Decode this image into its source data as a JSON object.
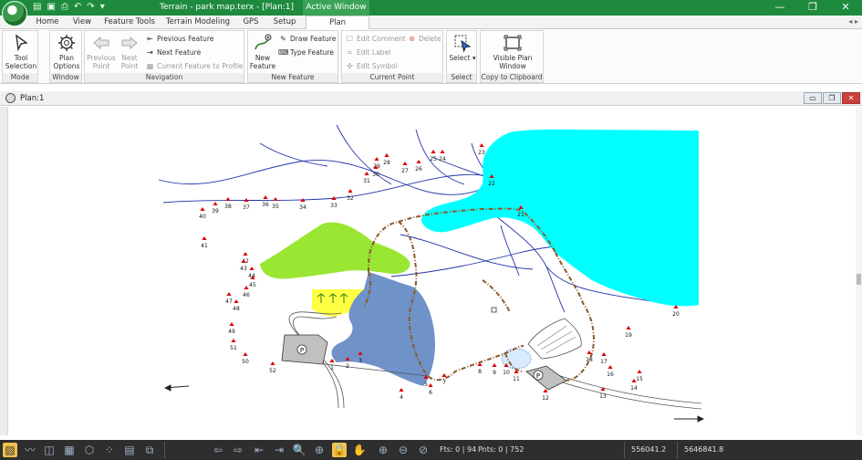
{
  "app": {
    "title": "Terrain - park map.terx - [Plan:1]",
    "active_window_label": "Active Window",
    "logo": "terrain-logo"
  },
  "window_controls": [
    "—",
    "❐",
    "✕"
  ],
  "tabs": [
    {
      "label": "Home"
    },
    {
      "label": "View"
    },
    {
      "label": "Feature Tools"
    },
    {
      "label": "Terrain Modeling"
    },
    {
      "label": "GPS"
    },
    {
      "label": "Setup"
    },
    {
      "label": "Plan",
      "active": true
    }
  ],
  "ribbon": {
    "mode": {
      "label": "Mode",
      "tool_selection": "Tool Selection ▾"
    },
    "window": {
      "label": "Window",
      "plan_options": "Plan Options"
    },
    "navigation": {
      "label": "Navigation",
      "previous_point": "Previous Point",
      "next_point": "Next Point",
      "previous_feature": "Previous Feature",
      "next_feature": "Next Feature",
      "current_feature_to_profile": "Current Feature to Profile"
    },
    "new_feature": {
      "label": "New Feature",
      "new_feature": "New Feature",
      "draw_feature": "Draw Feature",
      "type_feature": "Type Feature"
    },
    "current_point": {
      "label": "Current Point",
      "edit_comment": "Edit Comment",
      "delete": "Delete",
      "edit_label": "Edit Label",
      "edit_symbol": "Edit Symbol"
    },
    "select": {
      "label": "Select",
      "select": "Select ▾"
    },
    "clipboard": {
      "label": "Copy to Clipboard",
      "visible_plan_window": "Visible Plan Window"
    }
  },
  "document": {
    "title": "Plan:1"
  },
  "map": {
    "colors": {
      "lake": "#00ffff",
      "pond": "#6f93c8",
      "field": "#99e633",
      "garden": "#ffff44",
      "trail": "#8b5a2b",
      "stream": "#2233aa",
      "parking": "#c0c0c0"
    },
    "points": [
      {
        "id": "1"
      },
      {
        "id": "2"
      },
      {
        "id": "3"
      },
      {
        "id": "4"
      },
      {
        "id": "5"
      },
      {
        "id": "6"
      },
      {
        "id": "7"
      },
      {
        "id": "8"
      },
      {
        "id": "9"
      },
      {
        "id": "10"
      },
      {
        "id": "11"
      },
      {
        "id": "12"
      },
      {
        "id": "13"
      },
      {
        "id": "14"
      },
      {
        "id": "15"
      },
      {
        "id": "16"
      },
      {
        "id": "17"
      },
      {
        "id": "18"
      },
      {
        "id": "19"
      },
      {
        "id": "20"
      },
      {
        "id": "21"
      },
      {
        "id": "22"
      },
      {
        "id": "23"
      },
      {
        "id": "24"
      },
      {
        "id": "25"
      },
      {
        "id": "26"
      },
      {
        "id": "27"
      },
      {
        "id": "28"
      },
      {
        "id": "29"
      },
      {
        "id": "30"
      },
      {
        "id": "31"
      },
      {
        "id": "32"
      },
      {
        "id": "33"
      },
      {
        "id": "34"
      },
      {
        "id": "35"
      },
      {
        "id": "36"
      },
      {
        "id": "37"
      },
      {
        "id": "38"
      },
      {
        "id": "39"
      },
      {
        "id": "40"
      },
      {
        "id": "41"
      },
      {
        "id": "42"
      },
      {
        "id": "43"
      },
      {
        "id": "44"
      },
      {
        "id": "45"
      },
      {
        "id": "46"
      },
      {
        "id": "47"
      },
      {
        "id": "48"
      },
      {
        "id": "49"
      },
      {
        "id": "50"
      },
      {
        "id": "51"
      },
      {
        "id": "52"
      }
    ],
    "parking_symbol": "P"
  },
  "status": {
    "fts": "Fts: 0 | 94",
    "pnts": "Pnts: 0 | 752",
    "easting": "556041.2",
    "northing": "5646841.8"
  }
}
